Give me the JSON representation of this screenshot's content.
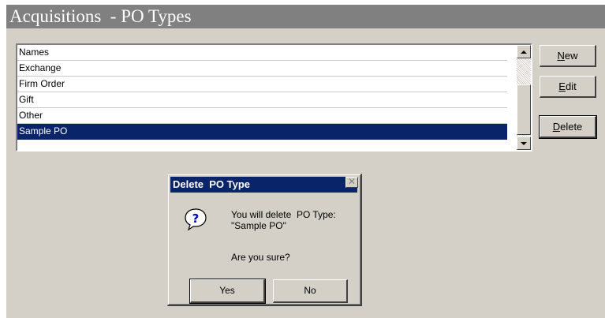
{
  "header": {
    "title": "Acquisitions  - PO Types"
  },
  "list": {
    "header": "Names",
    "items": [
      "Exchange",
      "Firm Order",
      "Gift",
      "Other",
      "Sample PO"
    ],
    "selected_index": 4
  },
  "buttons": {
    "new": {
      "accel": "N",
      "rest": "ew"
    },
    "edit": {
      "accel": "E",
      "rest": "dit"
    },
    "delete": {
      "accel": "D",
      "rest": "elete"
    }
  },
  "dialog": {
    "title": "Delete  PO Type",
    "close_glyph": "✕",
    "message_line1": "You will delete  PO Type:",
    "message_line2": "\"Sample PO\"",
    "confirm": "Are you sure?",
    "yes": "Yes",
    "no": "No",
    "icon": "question-icon"
  },
  "colors": {
    "panel": "#d4d0c8",
    "title_bar": "#808080",
    "selection": "#0a246a",
    "dialog_title": "#0a246a"
  }
}
